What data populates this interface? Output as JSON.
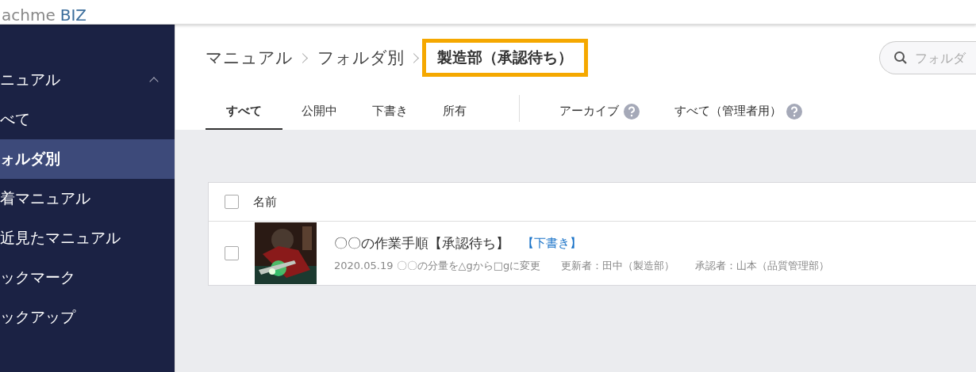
{
  "logo": {
    "text": "achme",
    "suffix": "BIZ"
  },
  "sidebar": {
    "items": [
      {
        "label": "ニュアル",
        "selected": false,
        "expanded": true
      },
      {
        "label": "べて",
        "selected": false
      },
      {
        "label": "ォルダ別",
        "selected": true
      },
      {
        "label": "着マニュアル",
        "selected": false
      },
      {
        "label": "近見たマニュアル",
        "selected": false
      },
      {
        "label": "ックマーク",
        "selected": false
      },
      {
        "label": "ックアップ",
        "selected": false
      }
    ]
  },
  "breadcrumb": [
    {
      "label": "マニュアル"
    },
    {
      "label": "フォルダ別"
    },
    {
      "label": "製造部（承認待ち）",
      "highlighted": true
    }
  ],
  "search": {
    "placeholder": "フォルダ"
  },
  "tabs": [
    {
      "label": "すべて",
      "selected": true
    },
    {
      "label": "公開中",
      "selected": false
    },
    {
      "label": "下書き",
      "selected": false
    },
    {
      "label": "所有",
      "selected": false
    },
    {
      "label": "アーカイブ",
      "selected": false,
      "help": true,
      "group_start": true
    },
    {
      "label": "すべて（管理者用）",
      "selected": false,
      "help": true
    }
  ],
  "table": {
    "columns": [
      "名前"
    ],
    "all_checked": false,
    "rows": [
      {
        "checked": false,
        "title": "〇〇の作業手順【承認待ち】",
        "badge": "【下書き】",
        "meta": [
          "2020.05.19 〇〇の分量を△gから□gに変更",
          "更新者：田中（製造部）",
          "承認者：山本（品質管理部）"
        ]
      }
    ]
  }
}
